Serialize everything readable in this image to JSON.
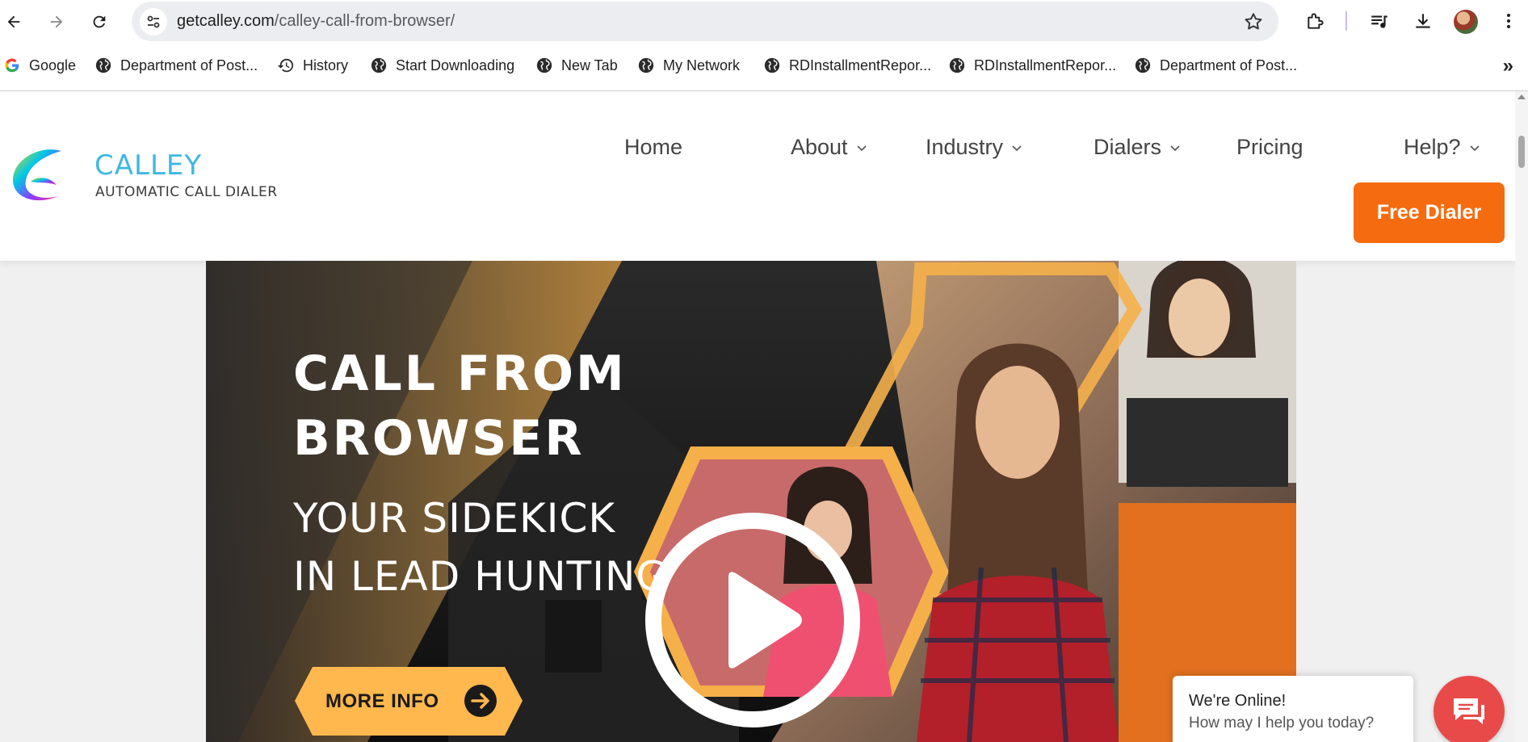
{
  "browser": {
    "url_host": "getcalley.com",
    "url_path": "/calley-call-from-browser/",
    "bookmarks": [
      {
        "label": "Google",
        "icon": "google-icon"
      },
      {
        "label": "Department of Post...",
        "icon": "globe-icon"
      },
      {
        "label": "History",
        "icon": "history-icon"
      },
      {
        "label": "Start Downloading",
        "icon": "globe-icon"
      },
      {
        "label": "New Tab",
        "icon": "globe-icon"
      },
      {
        "label": "My Network",
        "icon": "globe-icon"
      },
      {
        "label": "RDInstallmentRepor...",
        "icon": "globe-icon"
      },
      {
        "label": "RDInstallmentRepor...",
        "icon": "globe-icon"
      },
      {
        "label": "Department of Post...",
        "icon": "globe-icon"
      }
    ],
    "more_bookmarks": "»"
  },
  "site": {
    "brand_name": "CALLEY",
    "brand_tagline": "AUTOMATIC CALL DIALER",
    "menu": [
      {
        "label": "Home"
      },
      {
        "label": "About"
      },
      {
        "label": "Industry"
      },
      {
        "label": "Dialers"
      },
      {
        "label": "Pricing"
      },
      {
        "label": "Help?"
      }
    ],
    "cta_label": "Free Dialer",
    "accent_color": "#f56c10"
  },
  "hero": {
    "title_line1": "CALL FROM",
    "title_line2": "BROWSER",
    "subtitle_line1": "YOUR SIDEKICK",
    "subtitle_line2": "IN LEAD HUNTING",
    "button_label": "MORE INFO",
    "button_color": "#ffb84d"
  },
  "chat": {
    "title": "We're Online!",
    "subtitle": "How may I help you today?"
  }
}
